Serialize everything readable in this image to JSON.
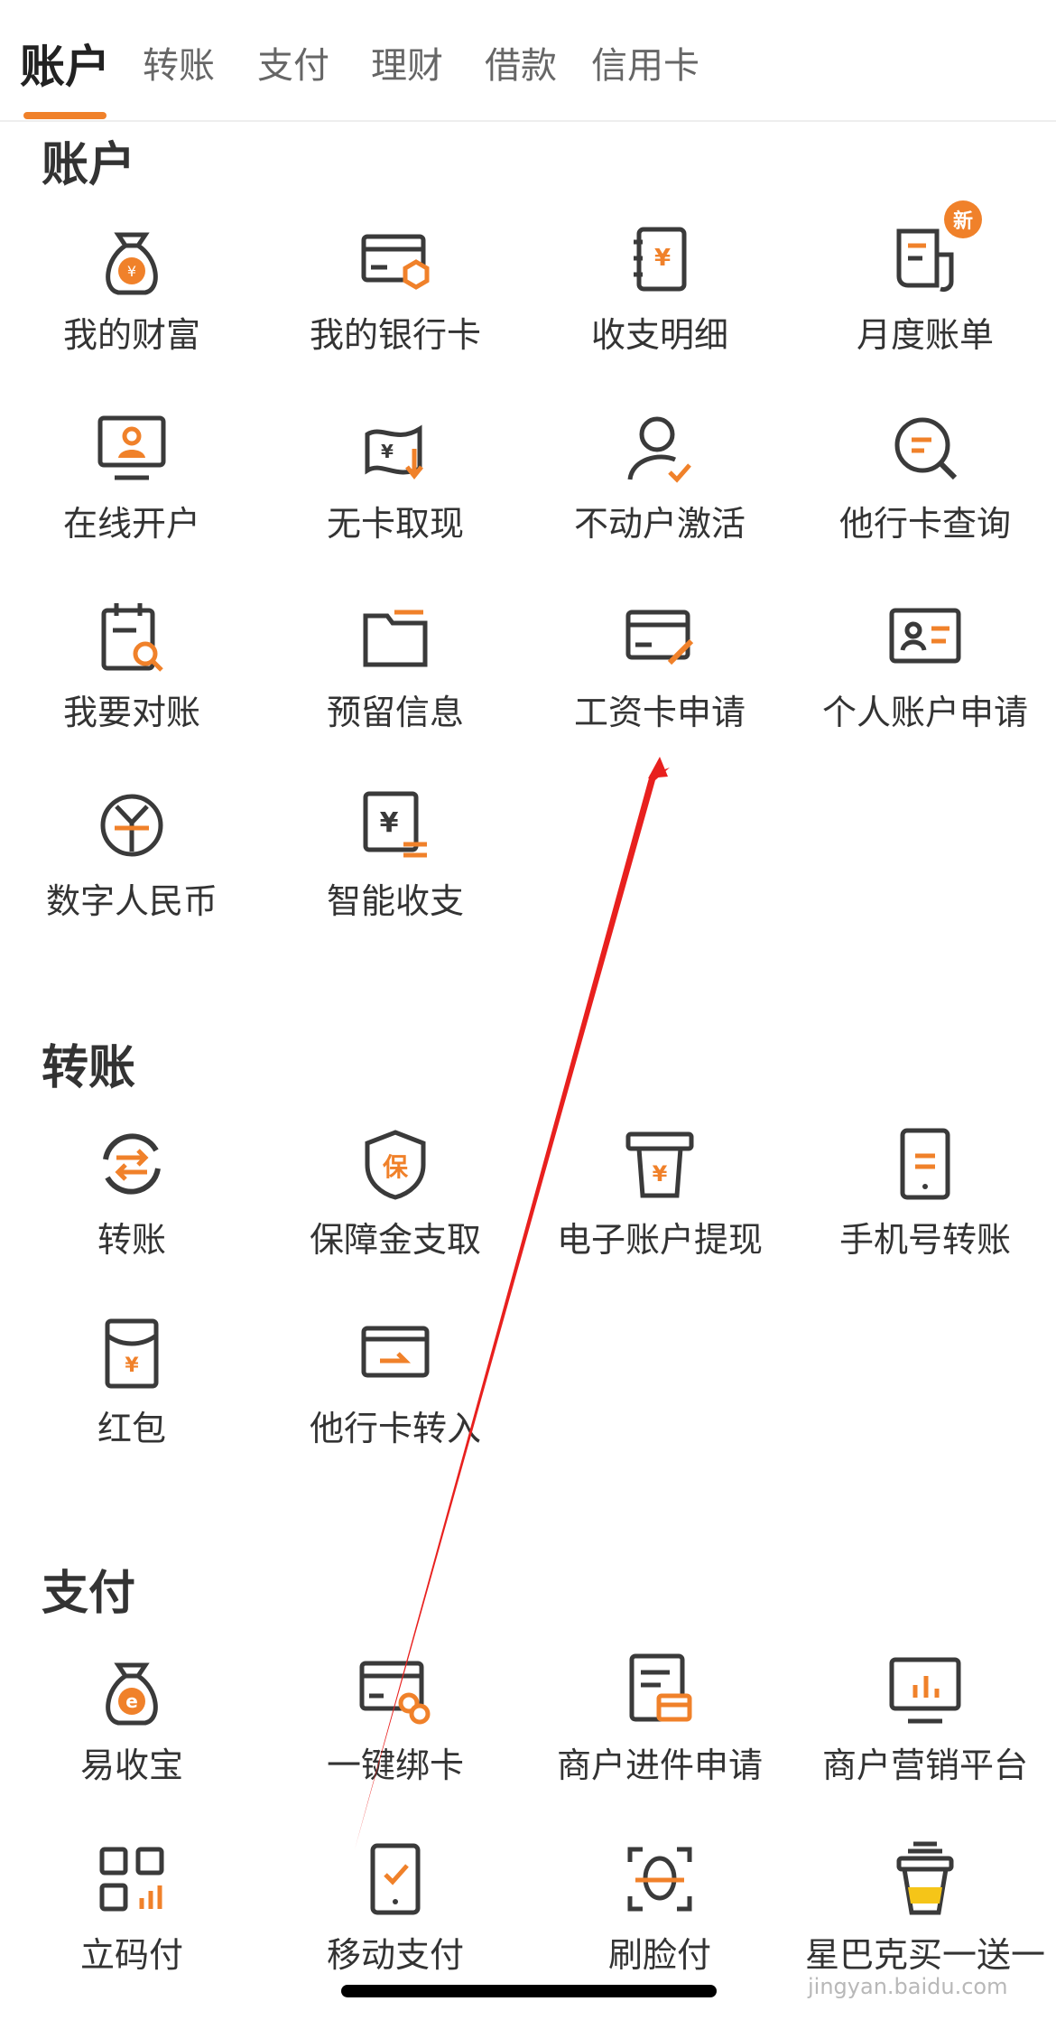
{
  "colors": {
    "accent": "#F0812A",
    "icon_dark": "#3A3A3A",
    "badge": "#F0812A",
    "annotation_arrow": "#E8201E"
  },
  "tabs": [
    {
      "label": "账户",
      "active": true
    },
    {
      "label": "转账",
      "active": false
    },
    {
      "label": "支付",
      "active": false
    },
    {
      "label": "理财",
      "active": false
    },
    {
      "label": "借款",
      "active": false
    },
    {
      "label": "信用卡",
      "active": false
    }
  ],
  "sections": [
    {
      "title": "账户",
      "items": [
        {
          "label": "我的财富",
          "icon": "money-bag-icon"
        },
        {
          "label": "我的银行卡",
          "icon": "bank-card-icon"
        },
        {
          "label": "收支明细",
          "icon": "ledger-icon"
        },
        {
          "label": "月度账单",
          "icon": "monthly-bill-icon",
          "badge": "新"
        },
        {
          "label": "在线开户",
          "icon": "monitor-user-icon"
        },
        {
          "label": "无卡取现",
          "icon": "cash-withdraw-icon"
        },
        {
          "label": "不动户激活",
          "icon": "user-check-icon"
        },
        {
          "label": "他行卡查询",
          "icon": "search-chat-icon"
        },
        {
          "label": "我要对账",
          "icon": "calendar-search-icon"
        },
        {
          "label": "预留信息",
          "icon": "folder-icon"
        },
        {
          "label": "工资卡申请",
          "icon": "card-edit-icon"
        },
        {
          "label": "个人账户申请",
          "icon": "id-card-icon"
        },
        {
          "label": "数字人民币",
          "icon": "digital-yuan-icon"
        },
        {
          "label": "智能收支",
          "icon": "smart-ledger-icon"
        }
      ]
    },
    {
      "title": "转账",
      "items": [
        {
          "label": "转账",
          "icon": "transfer-icon"
        },
        {
          "label": "保障金支取",
          "icon": "shield-bao-icon"
        },
        {
          "label": "电子账户提现",
          "icon": "atm-receipt-icon"
        },
        {
          "label": "手机号转账",
          "icon": "phone-transfer-icon"
        },
        {
          "label": "红包",
          "icon": "red-packet-icon"
        },
        {
          "label": "他行卡转入",
          "icon": "card-transfer-in-icon"
        }
      ]
    },
    {
      "title": "支付",
      "items": [
        {
          "label": "易收宝",
          "icon": "e-bag-icon"
        },
        {
          "label": "一键绑卡",
          "icon": "card-link-icon"
        },
        {
          "label": "商户进件申请",
          "icon": "merchant-apply-icon"
        },
        {
          "label": "商户营销平台",
          "icon": "chart-monitor-icon"
        },
        {
          "label": "立码付",
          "icon": "qr-code-icon"
        },
        {
          "label": "移动支付",
          "icon": "mobile-pay-icon"
        },
        {
          "label": "刷脸付",
          "icon": "face-scan-icon"
        },
        {
          "label": "星巴克买一送一",
          "icon": "coffee-cup-icon"
        }
      ]
    }
  ],
  "watermark": "jingyan.baidu.com"
}
